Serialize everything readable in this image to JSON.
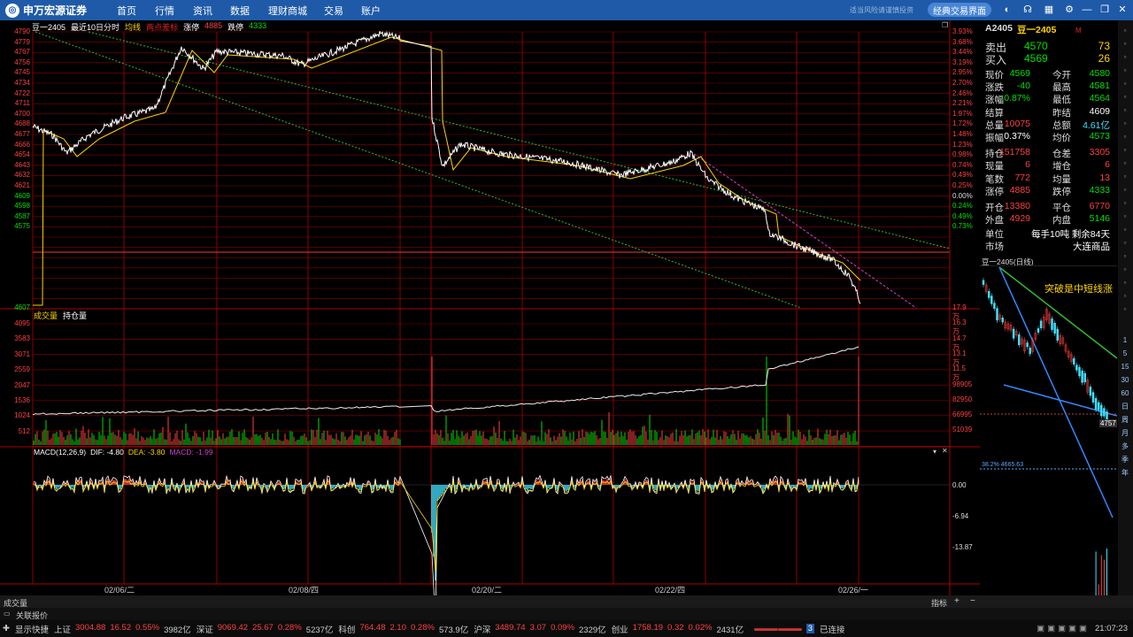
{
  "topbar": {
    "logo_text": "申万宏源证券",
    "logo_sub": "SHENWAN HONGYUAN SECURITIES",
    "nav": [
      "首页",
      "行情",
      "资讯",
      "数据",
      "理财商城",
      "交易",
      "账户"
    ],
    "classic_button": "经典交易界面",
    "faint_text": "适当风险请谨慎投资"
  },
  "chart_head": {
    "symbol": "豆一2405",
    "period": "最近10日分时",
    "avg_label": "均线",
    "two_day": "两点差标",
    "limit_up_label": "涨停",
    "limit_up_value": "4885",
    "limit_down_label": "跌停",
    "limit_down_value": "4333"
  },
  "price_axis_left": [
    "4790",
    "4779",
    "4767",
    "4756",
    "4745",
    "4734",
    "4722",
    "4711",
    "4700",
    "4688",
    "4677",
    "4666",
    "4654",
    "4643",
    "4632",
    "4621",
    "4609",
    "4598",
    "4587",
    "4575",
    "4607"
  ],
  "price_axis_right": [
    "3.93%",
    "3.68%",
    "3.44%",
    "3.19%",
    "2.95%",
    "2.70%",
    "2.46%",
    "2.21%",
    "1.97%",
    "1.72%",
    "1.48%",
    "1.23%",
    "0.98%",
    "0.74%",
    "0.49%",
    "0.25%",
    "0.00%",
    "0.24%",
    "0.49%",
    "0.73%"
  ],
  "volume_head": {
    "label1": "成交量",
    "label2": "持仓量"
  },
  "volume_axis_left": [
    "4095",
    "3583",
    "3071",
    "2559",
    "2047",
    "1536",
    "1024",
    "512"
  ],
  "volume_axis_right": [
    "17.9万",
    "16.3万",
    "14.7万",
    "13.1万",
    "11.5万",
    "98905",
    "82950",
    "66995",
    "51039"
  ],
  "macd_head": {
    "label": "MACD(12,26,9)",
    "dif": "DIF: -4.80",
    "dea": "DEA: -3.80",
    "macd": "MACD: -1.99"
  },
  "macd_axis_right": [
    "0.00",
    "-6.94",
    "-13.87"
  ],
  "date_labels": [
    "02/06/二",
    "02/08/四",
    "02/20/二",
    "02/22/四",
    "02/26/一"
  ],
  "info": {
    "code": "A2405",
    "name": "豆一2405",
    "sell_label": "卖出",
    "sell_price": "4570",
    "sell_vol": "73",
    "buy_label": "买入",
    "buy_price": "4569",
    "buy_vol": "26",
    "rows": [
      {
        "k": "现价",
        "v": "4569",
        "k2": "今开",
        "v2": "4580"
      },
      {
        "k": "涨跌",
        "v": "-40",
        "k2": "最高",
        "v2": "4581"
      },
      {
        "k": "涨幅",
        "v": "-0.87%",
        "k2": "最低",
        "v2": "4564"
      },
      {
        "k": "结算",
        "v": "",
        "k2": "昨结",
        "v2": "4609"
      },
      {
        "k": "总量",
        "v": "10075",
        "k2": "总额",
        "v2": "4.61亿"
      },
      {
        "k": "振幅",
        "v": "0.37%",
        "k2": "均价",
        "v2": "4573"
      },
      {
        "k": "持仓",
        "v": "151758",
        "k2": "仓差",
        "v2": "3305"
      },
      {
        "k": "现量",
        "v": "6",
        "k2": "增仓",
        "v2": "6"
      },
      {
        "k": "笔数",
        "v": "772",
        "k2": "均量",
        "v2": "13"
      },
      {
        "k": "涨停",
        "v": "4885",
        "k2": "跌停",
        "v2": "4333"
      },
      {
        "k": "开仓",
        "v": "13380",
        "k2": "平仓",
        "v2": "6770"
      },
      {
        "k": "外盘",
        "v": "4929",
        "k2": "内盘",
        "v2": "5146"
      }
    ],
    "unit_label": "单位",
    "unit_value": "每手10吨",
    "remain": "剩余84天",
    "market_label": "市场",
    "market_value": "大连商品"
  },
  "mini_chart": {
    "title": "豆一2405(日线)",
    "annotation": "突破是中短线涨",
    "price_tag": "4757",
    "fib_label": "38.2% 4665.63",
    "tabs": [
      "笔",
      "价",
      "细",
      "日",
      "联",
      "值",
      "主",
      "筹"
    ]
  },
  "right_toolbar": [
    "1",
    "5",
    "15",
    "30",
    "60",
    "日",
    "周",
    "月",
    "多",
    "季",
    "年"
  ],
  "status1": {
    "left": "成交量",
    "indicator": "指标",
    "plus": "+",
    "minus": "−"
  },
  "status2": {
    "left": "关联报价"
  },
  "ticker": {
    "show_quick": "显示快捷",
    "items": [
      {
        "name": "上证",
        "price": "3004.88",
        "chg": "16.52",
        "pct": "0.55%",
        "amt": "3982亿",
        "color": "red"
      },
      {
        "name": "深证",
        "price": "9069.42",
        "chg": "25.67",
        "pct": "0.28%",
        "amt": "5237亿",
        "color": "red"
      },
      {
        "name": "科创",
        "price": "764.48",
        "chg": "2.10",
        "pct": "0.28%",
        "amt": "573.9亿",
        "color": "red"
      },
      {
        "name": "沪深",
        "price": "3489.74",
        "chg": "3.07",
        "pct": "0.09%",
        "amt": "2329亿",
        "color": "red"
      },
      {
        "name": "创业",
        "price": "1758.19",
        "chg": "0.32",
        "pct": "0.02%",
        "amt": "2431亿",
        "color": "red"
      }
    ],
    "connected": "已连接",
    "time": "21:07:23"
  },
  "colors": {
    "nav_bg": "#1e5aa8",
    "grid": "#8b0000",
    "price_line": "#ffffff",
    "avg_line": "#ffd400",
    "up": "#ff4040",
    "down": "#00e000",
    "trend": "#2ebd2e"
  }
}
